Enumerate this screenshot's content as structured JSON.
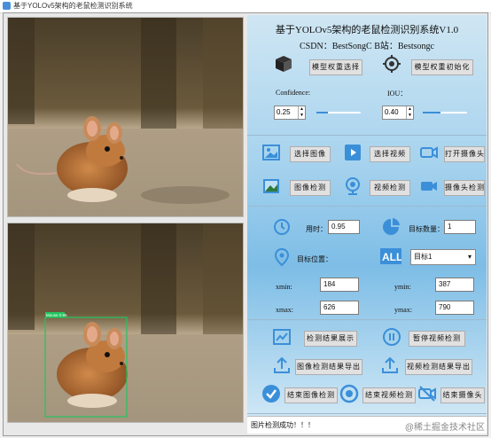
{
  "window": {
    "title": "基于YOLOv5架构的老鼠检测识别系统"
  },
  "header": {
    "title": "基于YOLOv5架构的老鼠检测识别系统V1.0",
    "csdn": "CSDN：BestSongC   B站：Bestsongc"
  },
  "model": {
    "select_label": "模型权重选择",
    "init_label": "模型权重初始化"
  },
  "params": {
    "confidence_label": "Confidence:",
    "confidence_value": "0.25",
    "confidence_fraction": 0.25,
    "iou_label": "IOU：",
    "iou_value": "0.40",
    "iou_fraction": 0.4
  },
  "input_buttons": {
    "select_image": "选择图像",
    "select_video": "选择视频",
    "open_camera": "打开摄像头",
    "detect_image": "图像检测",
    "detect_video": "视频检测",
    "detect_camera": "摄像头检测"
  },
  "info": {
    "time_label": "用时：",
    "time_value": "0.95",
    "count_label": "目标数量：",
    "count_value": "1",
    "position_label": "目标位置：",
    "target_select": "目标1",
    "xmin_label": "xmin:",
    "xmin_value": "184",
    "ymin_label": "ymin:",
    "ymin_value": "387",
    "xmax_label": "xmax:",
    "xmax_value": "626",
    "ymax_label": "ymax:",
    "ymax_value": "790"
  },
  "actions": {
    "show_results": "检测结果展示",
    "pause_video": "暂停视频检测",
    "export_image": "图像检测结果导出",
    "export_video": "视频检测结果导出",
    "end_image": "结束图像检测",
    "end_video": "结束视频检测",
    "end_camera": "结束摄像头"
  },
  "detection": {
    "box_label": "Mouse 0.95"
  },
  "status": {
    "message": "图片检测成功！！！",
    "watermark": "@稀土掘金技术社区"
  },
  "colors": {
    "accent": "#3b8fd9",
    "box": "#22c55e"
  }
}
